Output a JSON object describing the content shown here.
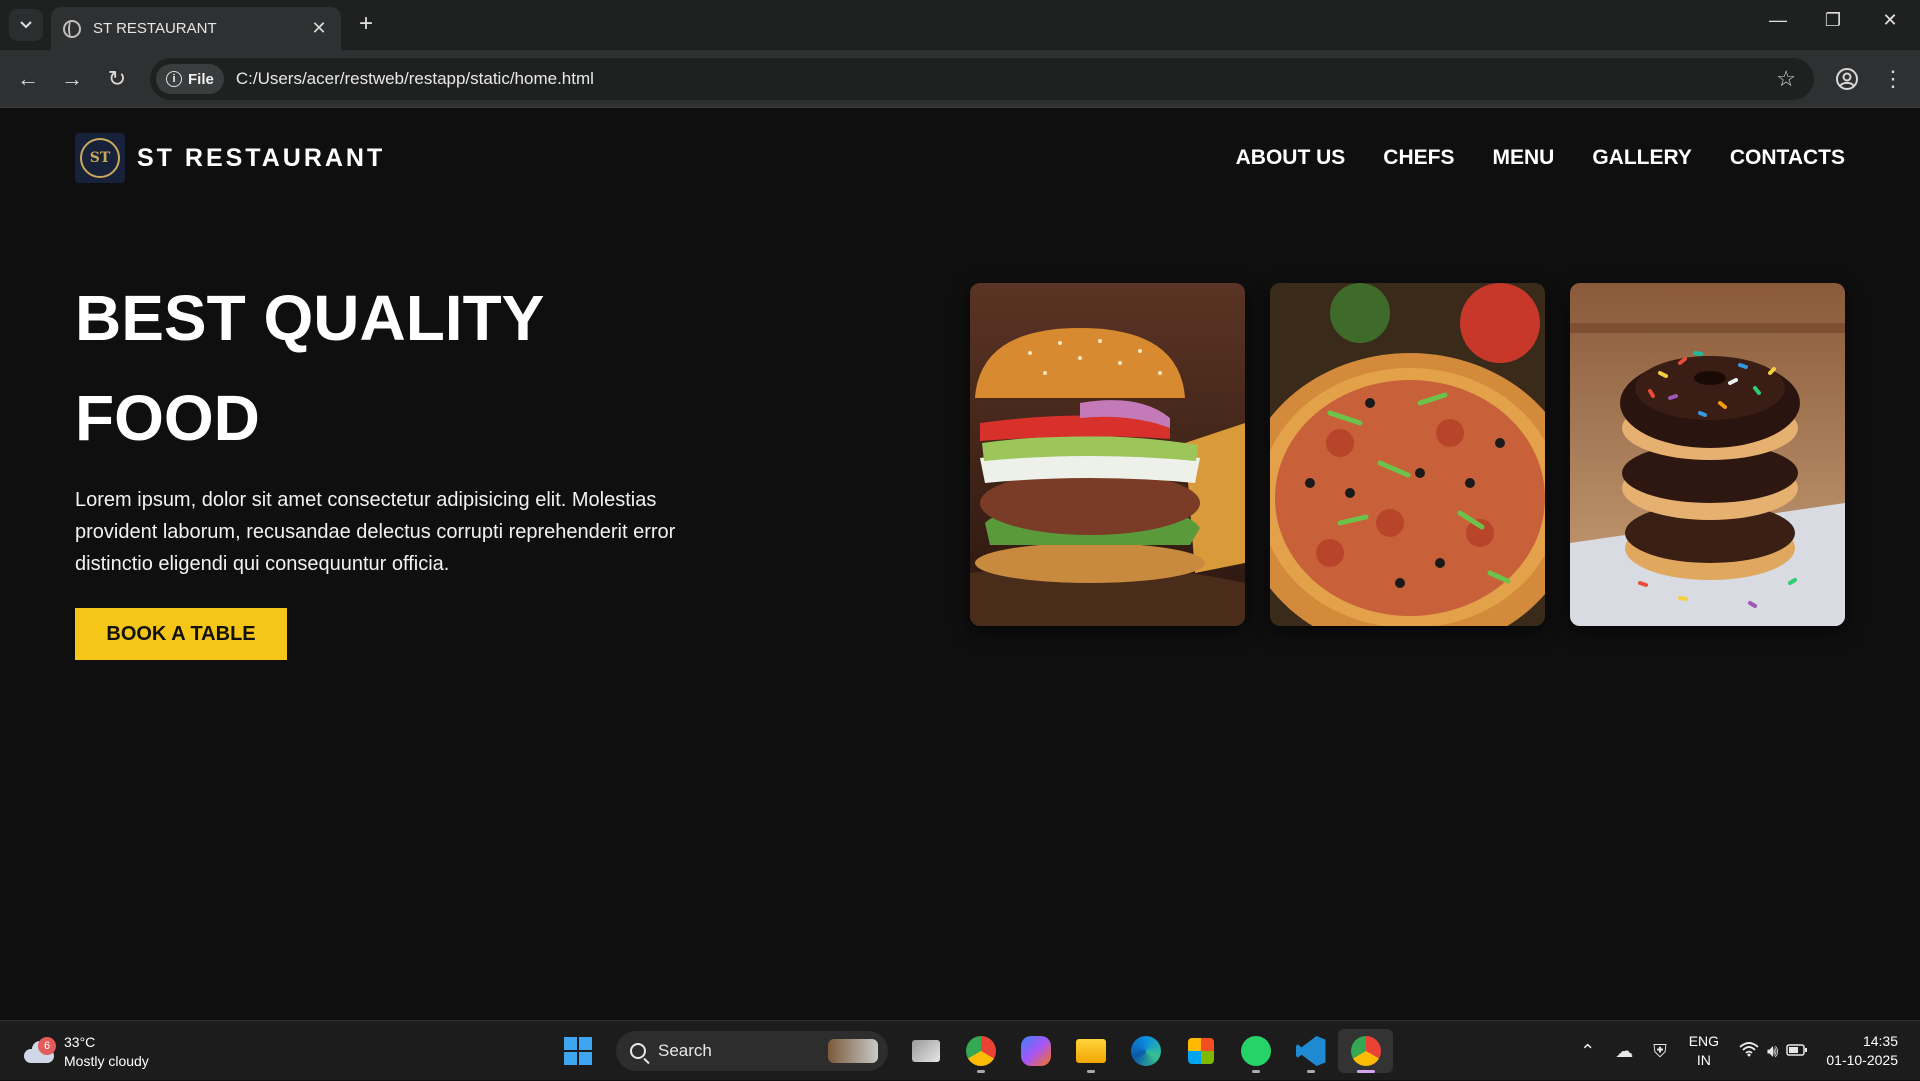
{
  "browser": {
    "tab_title": "ST RESTAURANT",
    "new_tab_label": "+",
    "chip_label": "File",
    "url": "C:/Users/acer/restweb/restapp/static/home.html"
  },
  "site": {
    "brand": "ST RESTAURANT",
    "logo_initials": "ST",
    "nav": [
      "ABOUT US",
      "CHEFS",
      "MENU",
      "GALLERY",
      "CONTACTS"
    ],
    "hero_line1": "BEST QUALITY",
    "hero_line2": "FOOD",
    "hero_text": "Lorem ipsum, dolor sit amet consectetur adipisicing elit. Molestias provident laborum, recusandae delectus corrupti reprehenderit error distinctio eligendi qui consequuntur officia.",
    "cta": "BOOK A TABLE",
    "accent_color": "#f5c518",
    "cards": [
      "burger-image",
      "pizza-image",
      "donuts-image"
    ]
  },
  "taskbar": {
    "weather_temp": "33°C",
    "weather_desc": "Mostly cloudy",
    "weather_badge": "6",
    "search_label": "Search",
    "lang_line1": "ENG",
    "lang_line2": "IN",
    "time": "14:35",
    "date": "01-10-2025"
  }
}
